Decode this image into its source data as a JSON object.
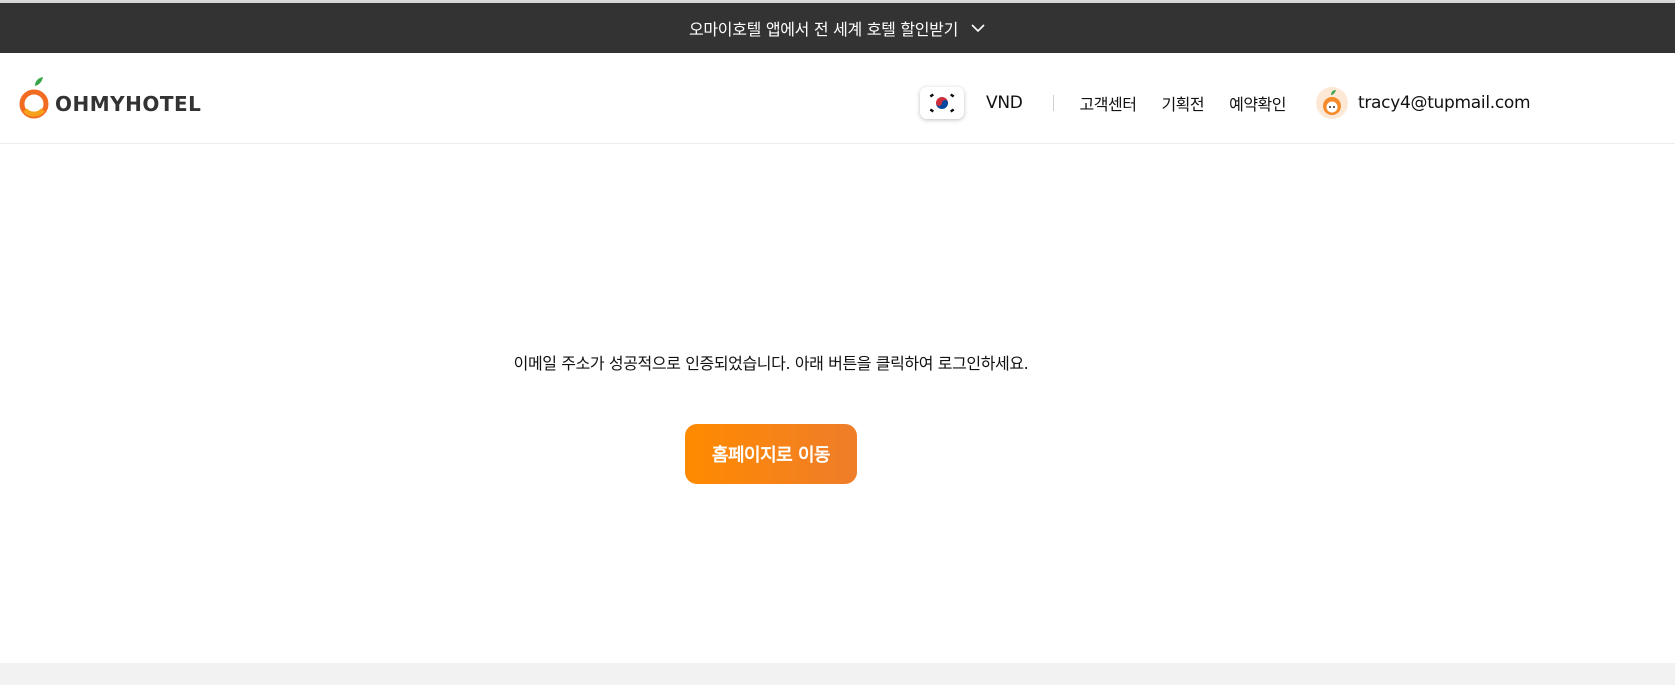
{
  "banner": {
    "text": "오마이호텔 앱에서 전 세계 호텔 할인받기",
    "icon": "chevron-down-icon"
  },
  "header": {
    "logo_text": "OHMYHOTEL",
    "flag_icon": "korea-flag-icon",
    "currency": "VND",
    "nav": [
      {
        "label": "고객센터"
      },
      {
        "label": "기획전"
      },
      {
        "label": "예약확인"
      }
    ],
    "user_email": "tracy4@tupmail.com"
  },
  "main": {
    "message": "이메일 주소가 성공적으로 인증되었습니다. 아래 버튼을 클릭하여 로그인하세요.",
    "home_button_label": "홈페이지로 이동"
  },
  "colors": {
    "banner_bg": "#333333",
    "accent": "#f5841f",
    "footer_bg": "#f2f2f2"
  }
}
